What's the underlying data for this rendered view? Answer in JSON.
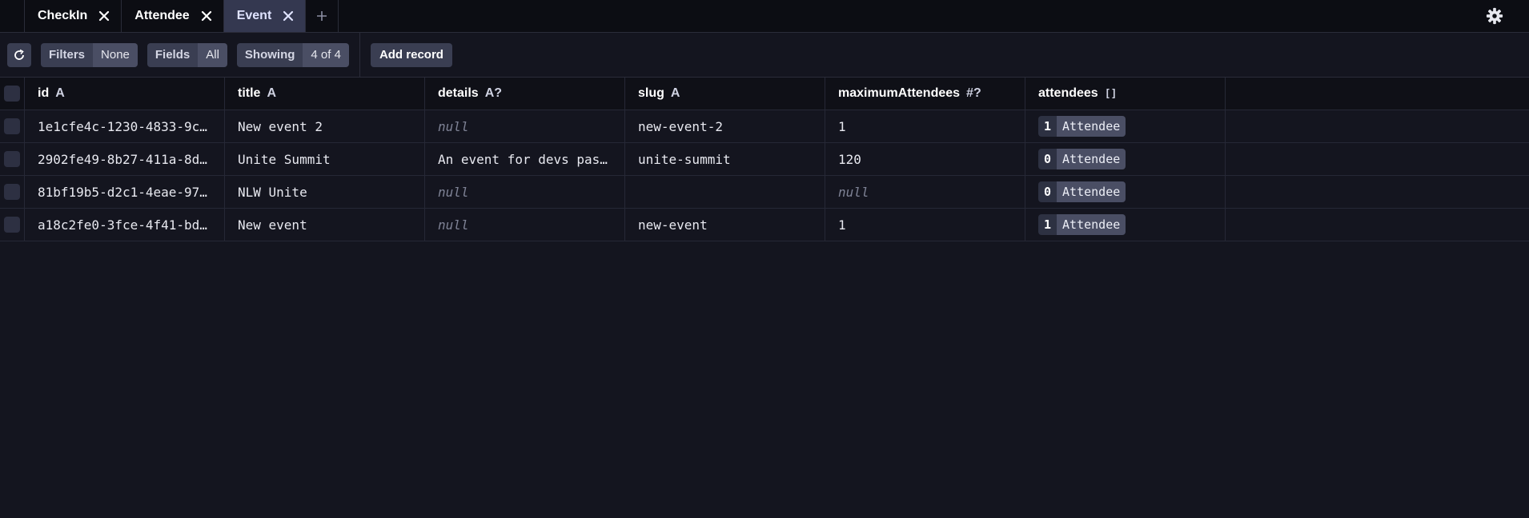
{
  "tabs": [
    {
      "label": "CheckIn",
      "active": false
    },
    {
      "label": "Attendee",
      "active": false
    },
    {
      "label": "Event",
      "active": true
    }
  ],
  "toolbar": {
    "filters_label": "Filters",
    "filters_value": "None",
    "fields_label": "Fields",
    "fields_value": "All",
    "showing_label": "Showing",
    "showing_value": "4 of 4",
    "add_record_label": "Add record"
  },
  "columns": [
    {
      "name": "id",
      "type": "A"
    },
    {
      "name": "title",
      "type": "A"
    },
    {
      "name": "details",
      "type": "A?"
    },
    {
      "name": "slug",
      "type": "A"
    },
    {
      "name": "maximumAttendees",
      "type": "#?"
    },
    {
      "name": "attendees",
      "type": "[]"
    }
  ],
  "rows": [
    {
      "id": "1e1cfe4c-1230-4833-9c…",
      "title": "New event 2",
      "details": "null",
      "slug": "new-event-2",
      "maximumAttendees": "1",
      "attendees_count": "1",
      "attendees_label": "Attendee"
    },
    {
      "id": "2902fe49-8b27-411a-8d…",
      "title": "Unite Summit",
      "details": "An event for devs pas…",
      "slug": "unite-summit",
      "maximumAttendees": "120",
      "attendees_count": "0",
      "attendees_label": "Attendee"
    },
    {
      "id": "81bf19b5-d2c1-4eae-97…",
      "title": "NLW Unite",
      "details": "null",
      "slug": "",
      "maximumAttendees": "null",
      "attendees_count": "0",
      "attendees_label": "Attendee"
    },
    {
      "id": "a18c2fe0-3fce-4f41-bd…",
      "title": "New event",
      "details": "null",
      "slug": "new-event",
      "maximumAttendees": "1",
      "attendees_count": "1",
      "attendees_label": "Attendee"
    }
  ],
  "colors": {
    "background": "#14151f",
    "tabbar": "#0c0d13",
    "active_tab": "#343850",
    "null_text": "#7f8396"
  },
  "icons": [
    "close-icon",
    "plus-icon",
    "gear-icon",
    "refresh-icon"
  ]
}
